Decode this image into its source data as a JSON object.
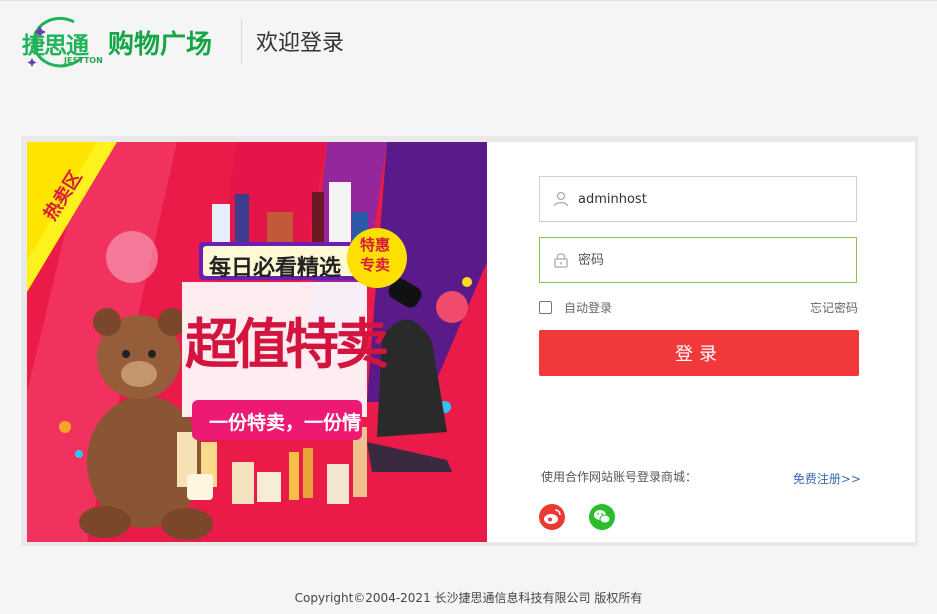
{
  "header": {
    "logo_cn": "捷思通",
    "logo_en": "JESTTON",
    "logo_sub": "购物广场",
    "title": "欢迎登录"
  },
  "banner": {
    "corner_tag": "热卖区",
    "headline": "每日必看精选",
    "badge_line1": "特惠",
    "badge_line2": "专卖",
    "main_text": "超值特卖",
    "slogan": "一份特卖，一份情"
  },
  "login": {
    "username_value": "adminhost",
    "password_placeholder": "密码",
    "remember_label": "自动登录",
    "forgot_label": "忘记密码",
    "submit_label": "登录",
    "partner_text": "使用合作网站账号登录商城：",
    "register_label": "免费注册>>"
  },
  "social": [
    {
      "icon": "weibo-icon",
      "color": "#e93a31"
    },
    {
      "icon": "wechat-icon",
      "color": "#2bbd2c"
    }
  ],
  "footer": {
    "copyright": "Copyright©2004-2021  长沙捷思通信息科技有限公司 版权所有"
  },
  "colors": {
    "brand_green": "#1fb35a",
    "login_red": "#f1383a",
    "focus_green": "#8bc34a",
    "banner_red": "#ea1b48",
    "link_blue": "#3a6ab1"
  }
}
